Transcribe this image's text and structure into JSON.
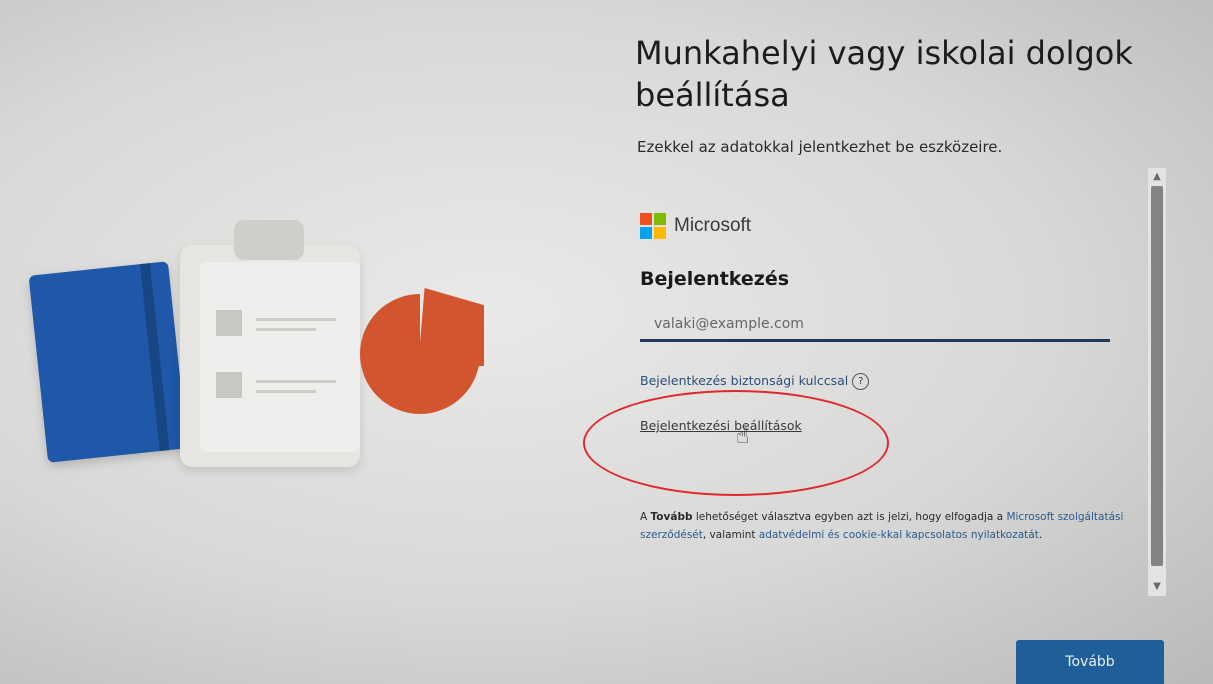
{
  "header": {
    "title": "Munkahelyi vagy iskolai dolgok beállítása",
    "subtitle": "Ezekkel az adatokkal jelentkezhet be eszközeire."
  },
  "signin": {
    "brand": "Microsoft",
    "brand_colors": [
      "#f25022",
      "#7fba00",
      "#00a4ef",
      "#ffb900"
    ],
    "heading": "Bejelentkezés",
    "email_placeholder": "valaki@example.com",
    "security_key_link": "Bejelentkezés biztonsági kulccsal",
    "help_icon_glyph": "?",
    "options_link": "Bejelentkezési beállítások"
  },
  "legal": {
    "prefix": "A ",
    "bold_word": "Tovább",
    "middle": " lehetőséget választva egyben azt is jelzi, hogy elfogadja a ",
    "link1": "Microsoft szolgáltatási szerződését",
    "and_text": ", valamint ",
    "link2": "adatvédelmi és cookie-kkal kapcsolatos nyilatkozatát",
    "suffix": "."
  },
  "footer": {
    "next_label": "Tovább"
  },
  "annotation": {
    "highlight_color": "#e0282f"
  }
}
